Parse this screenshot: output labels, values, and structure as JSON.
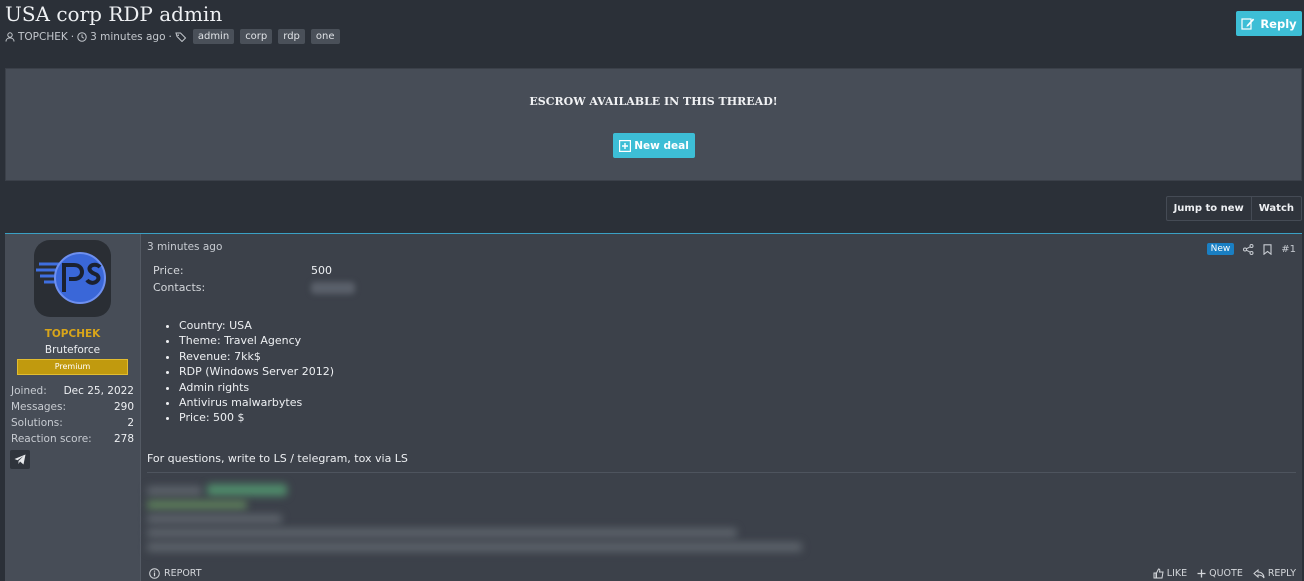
{
  "thread": {
    "title": "USA corp RDP admin",
    "author": "TOPCHEK",
    "posted": "3 minutes ago",
    "tags": [
      "admin",
      "corp",
      "rdp",
      "one"
    ],
    "reply_label": "Reply"
  },
  "escrow": {
    "title": "ESCROW AVAILABLE IN THIS THREAD!",
    "new_deal_label": "New deal"
  },
  "thread_buttons": {
    "jump_label": "Jump to new",
    "watch_label": "Watch"
  },
  "user": {
    "name": "TOPCHEK",
    "title": "Bruteforce",
    "badge": "Premium",
    "stats": [
      {
        "label": "Joined:",
        "value": "Dec 25, 2022"
      },
      {
        "label": "Messages:",
        "value": "290"
      },
      {
        "label": "Solutions:",
        "value": "2"
      },
      {
        "label": "Reaction score:",
        "value": "278"
      }
    ]
  },
  "post": {
    "time": "3 minutes ago",
    "new_label": "New",
    "number": "#1",
    "price_label": "Price:",
    "price_value": "500",
    "contacts_label": "Contacts:",
    "bullets": [
      "Country: USA",
      "Theme: Travel Agency",
      "Revenue: 7kk$",
      "RDP (Windows Server 2012)",
      "Admin rights",
      "Antivirus malwarbytes",
      "Price: 500 $"
    ],
    "note": "For questions, write to LS / telegram, tox via LS"
  },
  "footer": {
    "report": "REPORT",
    "like": "LIKE",
    "quote": "QUOTE",
    "reply": "REPLY"
  },
  "colors": {
    "accent": "#3dbed6",
    "username": "#d8a51a",
    "premium": "#c19a0e",
    "new_badge": "#1a7fc3"
  }
}
